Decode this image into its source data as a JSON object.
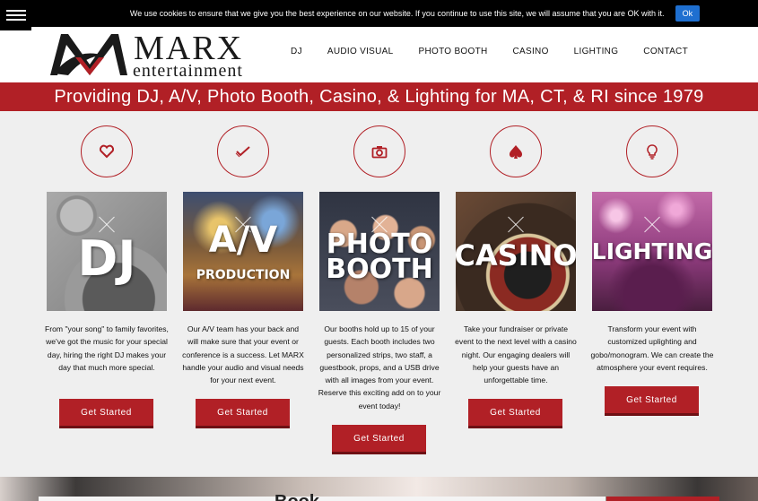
{
  "cookie": {
    "text": "We use cookies to ensure that we give you the best experience on our website. If you continue to use this site, we will assume that you are OK with it.",
    "ok_label": "Ok"
  },
  "brand": {
    "name": "MARX",
    "tagline": "entertainment",
    "color": "#b12026"
  },
  "nav": [
    "DJ",
    "AUDIO VISUAL",
    "PHOTO BOOTH",
    "CASINO",
    "LIGHTING",
    "CONTACT"
  ],
  "banner": "Providing DJ, A/V, Photo Booth, Casino, & Lighting for MA, CT, & RI since 1979",
  "services": [
    {
      "icon": "heart-icon",
      "image_title": "DJ",
      "image_subtitle": "",
      "description": "From \"your song\" to family favorites, we've got the music for your special day, hiring the right DJ makes your day that much more special.",
      "button": "Get Started"
    },
    {
      "icon": "check-icon",
      "image_title": "A/V",
      "image_subtitle": "PRODUCTION",
      "description": "Our A/V team has your back and will make sure that your event or conference is a success. Let MARX handle your audio and visual needs for your next event.",
      "button": "Get Started"
    },
    {
      "icon": "camera-icon",
      "image_title": "PHOTO BOOTH",
      "image_subtitle": "",
      "description": "Our booths hold up to 15 of your guests. Each booth includes two personalized strips, two staff, a guestbook, props, and a USB drive with all images from your event. Reserve this exciting add on to your event today!",
      "button": "Get Started"
    },
    {
      "icon": "spade-icon",
      "image_title": "CASINO",
      "image_subtitle": "",
      "description": "Take your fundraiser or private event to the next level with a casino night. Our engaging dealers  will help your guests have an unforgettable time.",
      "button": "Get Started"
    },
    {
      "icon": "lightbulb-icon",
      "image_title": "LIGHTING",
      "image_subtitle": "",
      "description": "Transform your event with customized uplighting and gobo/monogram. We can create the atmosphere your event requires.",
      "button": "Get Started"
    }
  ],
  "hero": {
    "heading_fragment": "Book"
  }
}
